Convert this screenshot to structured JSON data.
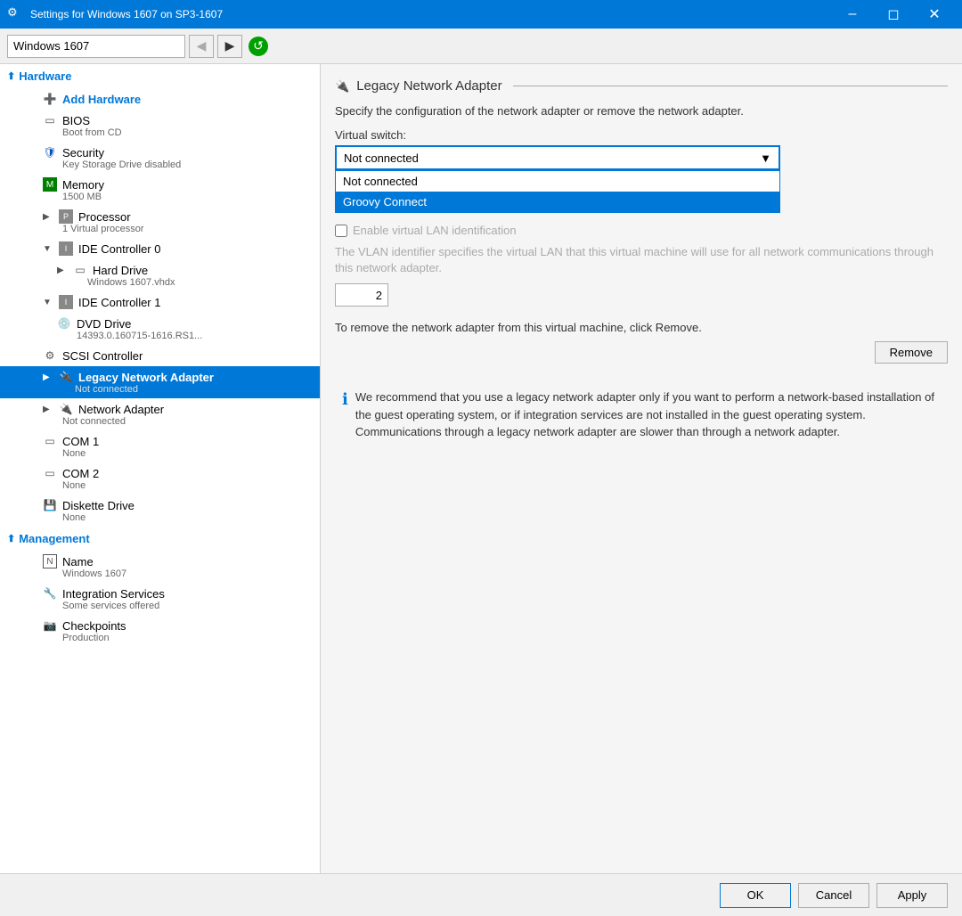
{
  "window": {
    "title": "Settings for Windows 1607 on SP3-1607",
    "icon": "⚙"
  },
  "toolbar": {
    "vm_selector_value": "Windows 1607",
    "vm_options": [
      "Windows 1607"
    ],
    "back_label": "◀",
    "forward_label": "▶",
    "refresh_label": "↺"
  },
  "sidebar": {
    "hardware_label": "Hardware",
    "management_label": "Management",
    "items": [
      {
        "id": "add-hardware",
        "label": "Add Hardware",
        "sublabel": "",
        "indent": 1,
        "icon": "➕",
        "icon_color": "#0078d7"
      },
      {
        "id": "bios",
        "label": "BIOS",
        "sublabel": "Boot from CD",
        "indent": 1,
        "icon": "▭",
        "icon_color": "#555"
      },
      {
        "id": "security",
        "label": "Security",
        "sublabel": "Key Storage Drive disabled",
        "indent": 1,
        "icon": "🛡",
        "icon_color": "#0050c0"
      },
      {
        "id": "memory",
        "label": "Memory",
        "sublabel": "1500 MB",
        "indent": 1,
        "icon": "▦",
        "icon_color": "#008000"
      },
      {
        "id": "processor",
        "label": "Processor",
        "sublabel": "1 Virtual processor",
        "indent": 1,
        "icon": "▦",
        "icon_color": "#555",
        "expandable": true,
        "expanded": false
      },
      {
        "id": "ide-ctrl-0",
        "label": "IDE Controller 0",
        "sublabel": "",
        "indent": 1,
        "icon": "▦",
        "icon_color": "#555",
        "expandable": true,
        "expanded": true
      },
      {
        "id": "hard-drive",
        "label": "Hard Drive",
        "sublabel": "Windows 1607.vhdx",
        "indent": 2,
        "icon": "▭",
        "icon_color": "#555",
        "expandable": true,
        "expanded": false
      },
      {
        "id": "ide-ctrl-1",
        "label": "IDE Controller 1",
        "sublabel": "",
        "indent": 1,
        "icon": "▦",
        "icon_color": "#555",
        "expandable": true,
        "expanded": true
      },
      {
        "id": "dvd-drive",
        "label": "DVD Drive",
        "sublabel": "14393.0.160715-1616.RS1...",
        "indent": 2,
        "icon": "💿",
        "icon_color": "#555"
      },
      {
        "id": "scsi-ctrl",
        "label": "SCSI Controller",
        "sublabel": "",
        "indent": 1,
        "icon": "⚙",
        "icon_color": "#555"
      },
      {
        "id": "legacy-net",
        "label": "Legacy Network Adapter",
        "sublabel": "Not connected",
        "indent": 1,
        "icon": "🔌",
        "icon_color": "#e8a000",
        "expandable": true,
        "expanded": false,
        "selected": true
      },
      {
        "id": "network-adapter",
        "label": "Network Adapter",
        "sublabel": "Not connected",
        "indent": 1,
        "icon": "🔌",
        "icon_color": "#555",
        "expandable": true,
        "expanded": false
      },
      {
        "id": "com1",
        "label": "COM 1",
        "sublabel": "None",
        "indent": 1,
        "icon": "▭",
        "icon_color": "#555"
      },
      {
        "id": "com2",
        "label": "COM 2",
        "sublabel": "None",
        "indent": 1,
        "icon": "▭",
        "icon_color": "#555"
      },
      {
        "id": "diskette",
        "label": "Diskette Drive",
        "sublabel": "None",
        "indent": 1,
        "icon": "💾",
        "icon_color": "#555"
      }
    ],
    "management_items": [
      {
        "id": "name",
        "label": "Name",
        "sublabel": "Windows 1607",
        "icon": "📝"
      },
      {
        "id": "integration",
        "label": "Integration Services",
        "sublabel": "Some services offered",
        "icon": "🔧"
      },
      {
        "id": "checkpoints",
        "label": "Checkpoints",
        "sublabel": "Production",
        "icon": "📷"
      }
    ]
  },
  "panel": {
    "title": "Legacy Network Adapter",
    "icon": "🔌",
    "description": "Specify the configuration of the network adapter or remove the network adapter.",
    "virtual_switch_label": "Virtual switch:",
    "current_value": "Not connected",
    "dropdown_options": [
      {
        "label": "Not connected",
        "selected": false
      },
      {
        "label": "Groovy Connect",
        "selected": true
      }
    ],
    "enable_vlan_label": "Enable virtual LAN identification",
    "vlan_description": "The VLAN identifier specifies the virtual LAN that this virtual machine will use for all network communications through this network adapter.",
    "vlan_value": "2",
    "remove_description": "To remove the network adapter from this virtual machine, click Remove.",
    "remove_label": "Remove",
    "info_text": "We recommend that you use a legacy network adapter only if you want to perform a network-based installation of the guest operating system, or if integration services are not installed in the guest operating system. Communications through a legacy network adapter are slower than through a network adapter."
  },
  "buttons": {
    "ok": "OK",
    "cancel": "Cancel",
    "apply": "Apply"
  }
}
